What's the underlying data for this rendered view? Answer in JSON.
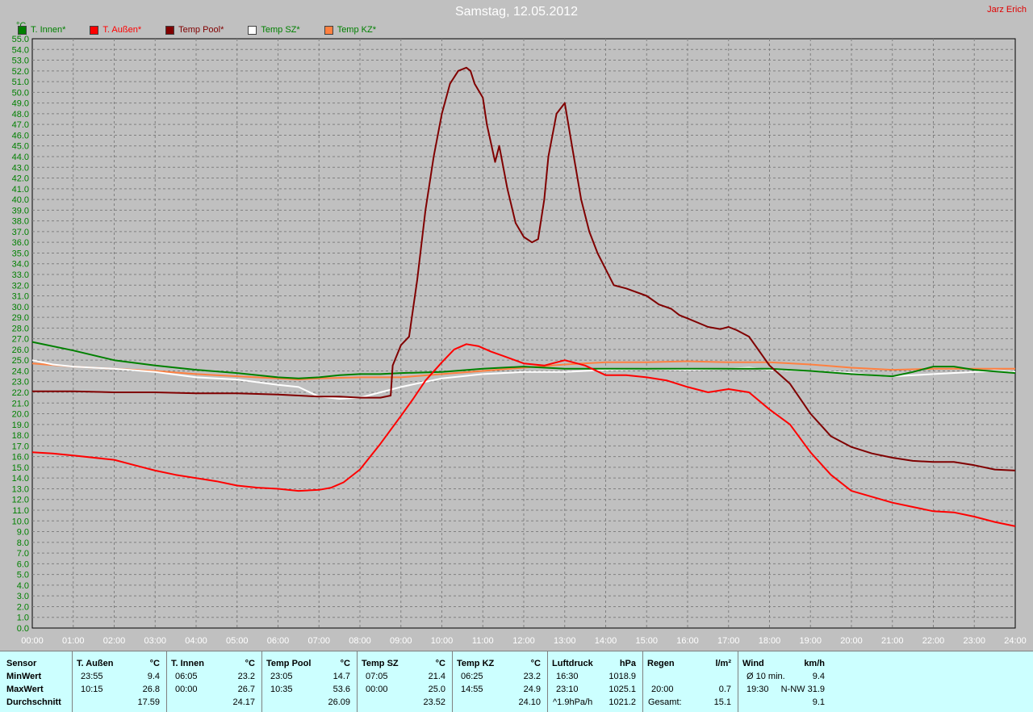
{
  "header": {
    "title": "Samstag, 12.05.2012",
    "author": "Jarz Erich",
    "unit": "°C"
  },
  "legend": [
    {
      "label": "T. Innen*",
      "color": "#008000"
    },
    {
      "label": "T. Außen*",
      "color": "#ff0000"
    },
    {
      "label": "Temp Pool*",
      "color": "#800000"
    },
    {
      "label": "Temp SZ*",
      "color": "#ffffff"
    },
    {
      "label": "Temp KZ*",
      "color": "#ff8040"
    }
  ],
  "chart_data": {
    "type": "line",
    "title": "Samstag, 12.05.2012",
    "ylabel": "°C",
    "ylim": [
      0,
      55
    ],
    "xlim": [
      0,
      24
    ],
    "y_ticks": [
      "0.0",
      "1.0",
      "2.0",
      "3.0",
      "4.0",
      "5.0",
      "6.0",
      "7.0",
      "8.0",
      "9.0",
      "10.0",
      "11.0",
      "12.0",
      "13.0",
      "14.0",
      "15.0",
      "16.0",
      "17.0",
      "18.0",
      "19.0",
      "20.0",
      "21.0",
      "22.0",
      "23.0",
      "24.0",
      "25.0",
      "26.0",
      "27.0",
      "28.0",
      "29.0",
      "30.0",
      "31.0",
      "32.0",
      "33.0",
      "34.0",
      "35.0",
      "36.0",
      "37.0",
      "38.0",
      "39.0",
      "40.0",
      "41.0",
      "42.0",
      "43.0",
      "44.0",
      "45.0",
      "46.0",
      "47.0",
      "48.0",
      "49.0",
      "50.0",
      "51.0",
      "52.0",
      "53.0",
      "54.0",
      "55.0"
    ],
    "x_ticks": [
      "00:00",
      "01:00",
      "02:00",
      "03:00",
      "04:00",
      "05:00",
      "06:00",
      "07:00",
      "08:00",
      "09:00",
      "10:00",
      "11:00",
      "12:00",
      "13:00",
      "14:00",
      "15:00",
      "16:00",
      "17:00",
      "18:00",
      "19:00",
      "20:00",
      "21:00",
      "22:00",
      "23:00",
      "24:00"
    ],
    "grid": true,
    "legend_position": "top-left",
    "series": [
      {
        "name": "T. Innen*",
        "color": "#008000",
        "x": [
          0,
          1,
          2,
          3,
          4,
          5,
          6,
          6.5,
          7,
          7.5,
          8,
          8.5,
          9,
          10,
          11,
          12,
          13,
          14,
          15,
          16,
          17,
          18,
          19,
          20,
          20.5,
          21,
          21.5,
          22,
          22.5,
          23,
          24
        ],
        "y": [
          26.7,
          25.9,
          25.0,
          24.5,
          24.1,
          23.8,
          23.4,
          23.3,
          23.4,
          23.6,
          23.7,
          23.7,
          23.8,
          23.9,
          24.2,
          24.4,
          24.2,
          24.2,
          24.2,
          24.2,
          24.2,
          24.2,
          24.0,
          23.7,
          23.6,
          23.5,
          23.9,
          24.4,
          24.4,
          24.1,
          23.8
        ]
      },
      {
        "name": "T. Außen*",
        "color": "#ff0000",
        "x": [
          0,
          0.5,
          1,
          2,
          2.5,
          3,
          3.5,
          4,
          4.5,
          5,
          5.5,
          6,
          6.5,
          7,
          7.3,
          7.6,
          8,
          8.5,
          9,
          9.3,
          9.6,
          10,
          10.3,
          10.6,
          10.9,
          11.2,
          11.5,
          12,
          12.5,
          13,
          13.5,
          14,
          14.5,
          15,
          15.5,
          16,
          16.5,
          17,
          17.5,
          18,
          18.5,
          19,
          19.5,
          20,
          21,
          22,
          22.5,
          23,
          23.5,
          24
        ],
        "y": [
          16.4,
          16.3,
          16.1,
          15.7,
          15.2,
          14.7,
          14.3,
          14.0,
          13.7,
          13.3,
          13.1,
          13.0,
          12.8,
          12.9,
          13.1,
          13.6,
          14.8,
          17.2,
          19.8,
          21.4,
          23.1,
          24.8,
          26.0,
          26.5,
          26.3,
          25.8,
          25.4,
          24.7,
          24.5,
          25.0,
          24.5,
          23.6,
          23.6,
          23.4,
          23.1,
          22.5,
          22.0,
          22.3,
          22.0,
          20.4,
          19.0,
          16.4,
          14.3,
          12.8,
          11.7,
          10.9,
          10.8,
          10.4,
          9.9,
          9.5
        ]
      },
      {
        "name": "Temp Pool*",
        "color": "#800000",
        "x": [
          0,
          1,
          2,
          3,
          4,
          5,
          6,
          6.5,
          7,
          7.5,
          8,
          8.5,
          8.75,
          8.8,
          9,
          9.2,
          9.4,
          9.6,
          9.8,
          10,
          10.2,
          10.4,
          10.6,
          10.7,
          10.8,
          11,
          11.1,
          11.3,
          11.4,
          11.6,
          11.8,
          12,
          12.2,
          12.35,
          12.5,
          12.6,
          12.8,
          13,
          13.2,
          13.4,
          13.6,
          13.8,
          14,
          14.2,
          14.5,
          15,
          15.3,
          15.6,
          15.8,
          16,
          16.5,
          16.8,
          17,
          17.2,
          17.5,
          18,
          18.5,
          19,
          19.5,
          20,
          20.5,
          21,
          21.5,
          22,
          22.5,
          23,
          23.5,
          24
        ],
        "y": [
          22.1,
          22.1,
          22.0,
          22.0,
          21.9,
          21.9,
          21.8,
          21.7,
          21.6,
          21.6,
          21.5,
          21.5,
          21.7,
          24.5,
          26.4,
          27.2,
          32.5,
          39.0,
          44.0,
          48.0,
          50.8,
          52.0,
          52.3,
          52.0,
          50.8,
          49.5,
          47.0,
          43.5,
          45.0,
          41.0,
          37.8,
          36.5,
          36.0,
          36.3,
          40.0,
          44.0,
          48.0,
          49.0,
          44.5,
          40.0,
          37.0,
          35.0,
          33.5,
          32.0,
          31.7,
          31.0,
          30.2,
          29.8,
          29.2,
          28.9,
          28.1,
          27.9,
          28.1,
          27.8,
          27.2,
          24.5,
          22.8,
          20.0,
          17.9,
          16.9,
          16.3,
          15.9,
          15.6,
          15.5,
          15.5,
          15.2,
          14.8,
          14.7
        ]
      },
      {
        "name": "Temp SZ*",
        "color": "#ffffff",
        "x": [
          0,
          0.5,
          1,
          2,
          3,
          4,
          5,
          6,
          6.5,
          7,
          7.5,
          8,
          8.5,
          9,
          10,
          11,
          12,
          13,
          14,
          15,
          16,
          17,
          17.5,
          18,
          19,
          20,
          20.5,
          21,
          22,
          23,
          23.5,
          24
        ],
        "y": [
          25.0,
          24.6,
          24.4,
          24.2,
          23.9,
          23.4,
          23.2,
          22.7,
          22.5,
          21.6,
          21.4,
          21.5,
          22.0,
          22.5,
          23.3,
          23.7,
          23.9,
          23.9,
          24.1,
          24.2,
          24.1,
          24.2,
          24.3,
          24.1,
          24.0,
          23.8,
          23.6,
          23.5,
          23.7,
          23.9,
          24.0,
          23.9
        ]
      },
      {
        "name": "Temp KZ*",
        "color": "#ff8040",
        "x": [
          0,
          1,
          2,
          3,
          4,
          5,
          6,
          6.5,
          7,
          8,
          9,
          10,
          11,
          12,
          13,
          14,
          15,
          16,
          17,
          18,
          19,
          20,
          21,
          22,
          23,
          24
        ],
        "y": [
          24.7,
          24.4,
          24.2,
          24.0,
          23.7,
          23.5,
          23.3,
          23.2,
          23.3,
          23.4,
          23.4,
          23.7,
          24.0,
          24.3,
          24.6,
          24.8,
          24.8,
          24.9,
          24.8,
          24.8,
          24.6,
          24.3,
          24.1,
          24.2,
          24.2,
          24.2
        ]
      }
    ]
  },
  "stats": {
    "row_labels": [
      "Sensor",
      "MinWert",
      "MaxWert",
      "Durchschnitt"
    ],
    "columns": [
      {
        "name": "T. Außen",
        "unit": "°C",
        "min_time": "23:55",
        "min_val": "9.4",
        "max_time": "10:15",
        "max_val": "26.8",
        "avg_label": "",
        "avg": "17.59"
      },
      {
        "name": "T. Innen",
        "unit": "°C",
        "min_time": "06:05",
        "min_val": "23.2",
        "max_time": "00:00",
        "max_val": "26.7",
        "avg_label": "",
        "avg": "24.17"
      },
      {
        "name": "Temp Pool",
        "unit": "°C",
        "min_time": "23:05",
        "min_val": "14.7",
        "max_time": "10:35",
        "max_val": "53.6",
        "avg_label": "",
        "avg": "26.09"
      },
      {
        "name": "Temp SZ",
        "unit": "°C",
        "min_time": "07:05",
        "min_val": "21.4",
        "max_time": "00:00",
        "max_val": "25.0",
        "avg_label": "",
        "avg": "23.52"
      },
      {
        "name": "Temp KZ",
        "unit": "°C",
        "min_time": "06:25",
        "min_val": "23.2",
        "max_time": "14:55",
        "max_val": "24.9",
        "avg_label": "",
        "avg": "24.10"
      },
      {
        "name": "Luftdruck",
        "unit": "hPa",
        "min_time": "16:30",
        "min_val": "1018.9",
        "max_time": "23:10",
        "max_val": "1025.1",
        "avg_label": "^1.9hPa/h",
        "avg": "1021.2"
      },
      {
        "name": "Regen",
        "unit": "l/m²",
        "min_time": "",
        "min_val": "",
        "max_time": "20:00",
        "max_val": "0.7",
        "avg_label": "Gesamt:",
        "avg": "15.1"
      },
      {
        "name": "Wind",
        "unit": "km/h",
        "min_time": "Ø 10 min.",
        "min_val": "9.4",
        "max_time": "19:30",
        "max_val": "N-NW 31.9",
        "avg_label": "",
        "avg": "9.1"
      }
    ]
  }
}
